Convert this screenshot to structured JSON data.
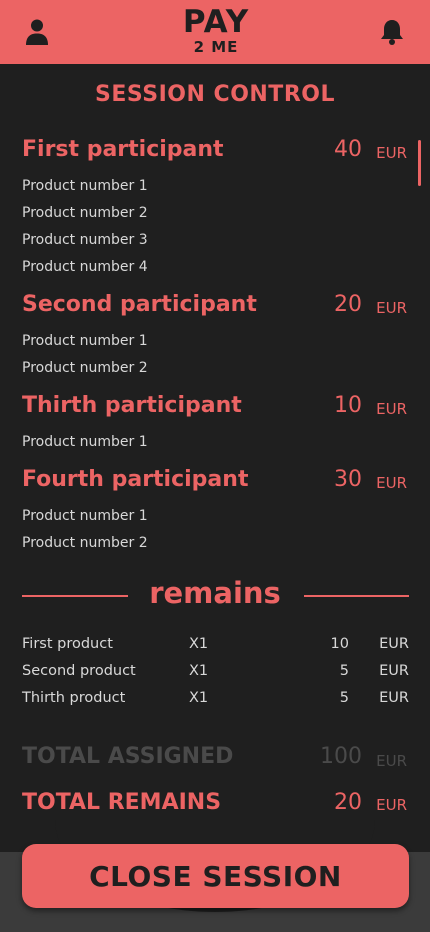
{
  "header": {
    "logo_main": "PAY",
    "logo_sub": "2 ME",
    "user_icon": "user-icon",
    "bell_icon": "bell-icon"
  },
  "title": "SESSION CONTROL",
  "currency": "EUR",
  "participants": [
    {
      "name": "First participant",
      "amount": "40",
      "products": [
        "Product number 1",
        "Product number 2",
        "Product number 3",
        "Product number 4"
      ]
    },
    {
      "name": "Second participant",
      "amount": "20",
      "products": [
        "Product number 1",
        "Product number 2"
      ]
    },
    {
      "name": "Thirth participant",
      "amount": "10",
      "products": [
        "Product number 1"
      ]
    },
    {
      "name": "Fourth participant",
      "amount": "30",
      "products": [
        "Product number 1",
        "Product number 2"
      ]
    }
  ],
  "remains": {
    "title": "remains",
    "items": [
      {
        "name": "First product",
        "qty": "X1",
        "amount": "10",
        "currency": "EUR"
      },
      {
        "name": "Second product",
        "qty": "X1",
        "amount": "5",
        "currency": "EUR"
      },
      {
        "name": "Thirth product",
        "qty": "X1",
        "amount": "5",
        "currency": "EUR"
      }
    ]
  },
  "totals": {
    "assigned_label": "TOTAL ASSIGNED",
    "assigned_amount": "100",
    "remains_label": "TOTAL REMAINS",
    "remains_amount": "20"
  },
  "close_button": "CLOSE SESSION",
  "colors": {
    "accent": "#ec6464",
    "background": "#1f1f1f",
    "muted": "#4a4a4a"
  }
}
